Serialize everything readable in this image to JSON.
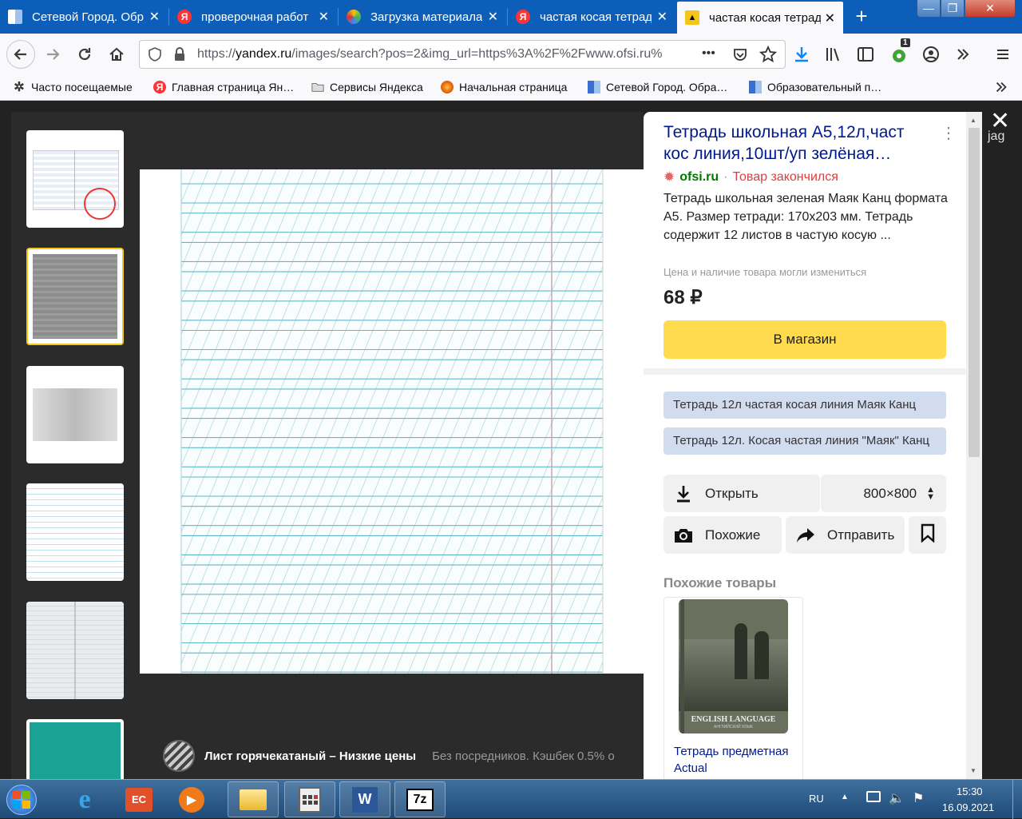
{
  "tabs": [
    {
      "title": "Сетевой Город. Обр",
      "icon": "grid-favicon"
    },
    {
      "title": "проверочная работ",
      "icon": "yandex-favicon"
    },
    {
      "title": "Загрузка материала",
      "icon": "colorful-favicon"
    },
    {
      "title": "частая косая тетрад",
      "icon": "yandex-favicon"
    },
    {
      "title": "частая косая тетрад",
      "icon": "image-favicon",
      "active": true
    }
  ],
  "window_controls": {
    "minimize": "—",
    "maximize": "❐",
    "close": "✕"
  },
  "url": {
    "prefix": "https://",
    "domain": "yandex.ru",
    "rest": "/images/search?pos=2&img_url=https%3A%2F%2Fwww.ofsi.ru%",
    "menu": "•••"
  },
  "extensions": {
    "badge": "1"
  },
  "bookmarks": [
    {
      "label": "Часто посещаемые",
      "icon": "gear-icon"
    },
    {
      "label": "Главная страница Ян…",
      "icon": "yandex-icon"
    },
    {
      "label": "Сервисы Яндекса",
      "icon": "folder-icon"
    },
    {
      "label": "Начальная страница",
      "icon": "firefox-icon"
    },
    {
      "label": "Сетевой Город. Обра…",
      "icon": "grid-icon"
    },
    {
      "label": "Образовательный п…",
      "icon": "grid-icon"
    }
  ],
  "ad": {
    "title": "Лист горячекатаный – Низкие цены",
    "text": "Без посредников. Кэшбек 0.5% о"
  },
  "panel": {
    "title": "Тетрадь школьная А5,12л,част кос линия,10шт/уп зелёная…",
    "site": "ofsi.ru",
    "separator": "·",
    "status": "Товар закончился",
    "description": "Тетрадь школьная зеленая Маяк Канц формата А5. Размер тетради: 170х203 мм. Тетрадь содержит 12 листов в частую косую ...",
    "note": "Цена и наличие товара могли измениться",
    "price": "68 ₽",
    "buy": "В магазин",
    "tags": [
      "Тетрадь 12л частая косая линия Маяк Канц",
      "Тетрадь 12л. Косая частая линия \"Маяк\" Канц"
    ],
    "open": "Открыть",
    "size": "800×800",
    "similar": "Похожие",
    "share": "Отправить",
    "similar_goods": "Похожие товары",
    "card": {
      "cover_text": "ENGLISH LANGUAGE",
      "cover_sub": "АНГЛИЙСКИЙ ЯЗЫК",
      "caption": "Тетрадь предметная Actual"
    }
  },
  "close": "✕",
  "edge_text": "jag",
  "tray": {
    "lang": "RU",
    "time": "15:30",
    "date": "16.09.2021"
  }
}
